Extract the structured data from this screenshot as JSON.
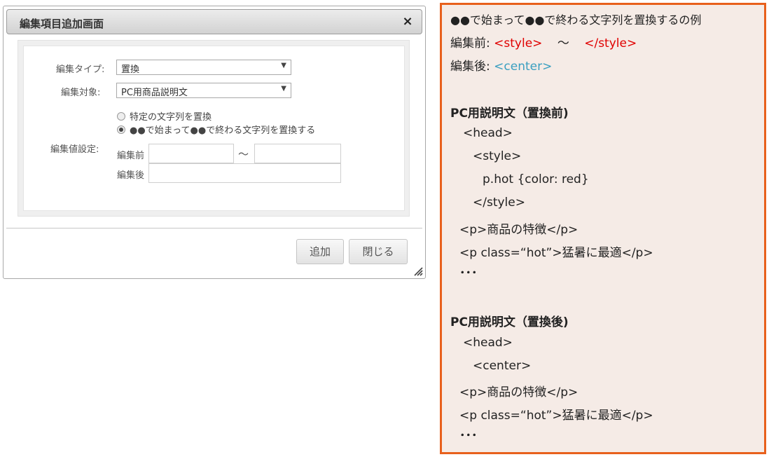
{
  "dialog": {
    "title": "編集項目追加画面",
    "close_icon": "×",
    "fields": {
      "edit_type_label": "編集タイプ:",
      "edit_type_value": "置換",
      "edit_target_label": "編集対象:",
      "edit_target_value": "PC用商品説明文",
      "edit_value_label": "編集値設定:",
      "radio_options": [
        {
          "label": "特定の文字列を置換",
          "checked": false
        },
        {
          "label": "●●で始まって●●で終わる文字列を置換する",
          "checked": true
        }
      ],
      "before_label": "編集前",
      "after_label": "編集後",
      "tilde": "〜",
      "before_start_value": "",
      "before_end_value": "",
      "after_value": ""
    },
    "buttons": {
      "add": "追加",
      "close": "閉じる"
    }
  },
  "note": {
    "heading": "●●で始まって●●で終わる文字列を置換するの例",
    "before_label": "編集前:",
    "before_start": "<style>",
    "before_tilde": "〜",
    "before_end": "</style>",
    "after_label": "編集後:",
    "after_value": "<center>",
    "section1_title": "PC用説明文（置換前)",
    "section1_lines": {
      "head": "<head>",
      "style_open": "<style>",
      "style_rule": "p.hot {color: red}",
      "style_close": "</style>",
      "p1": "<p>商品の特徴</p>",
      "p2": "<p class=“hot”>猛暑に最適</p>",
      "ellipsis": "･･･"
    },
    "section2_title": "PC用説明文（置換後)",
    "section2_lines": {
      "head": "<head>",
      "center": "<center>",
      "p1": "<p>商品の特徴</p>",
      "p2": "<p class=“hot”>猛暑に最適</p>",
      "ellipsis": "･･･"
    }
  },
  "colors": {
    "accent_orange": "#e8601c",
    "note_background": "#f5ebe6",
    "code_red": "#e00000",
    "code_teal": "#3a9fc0"
  }
}
